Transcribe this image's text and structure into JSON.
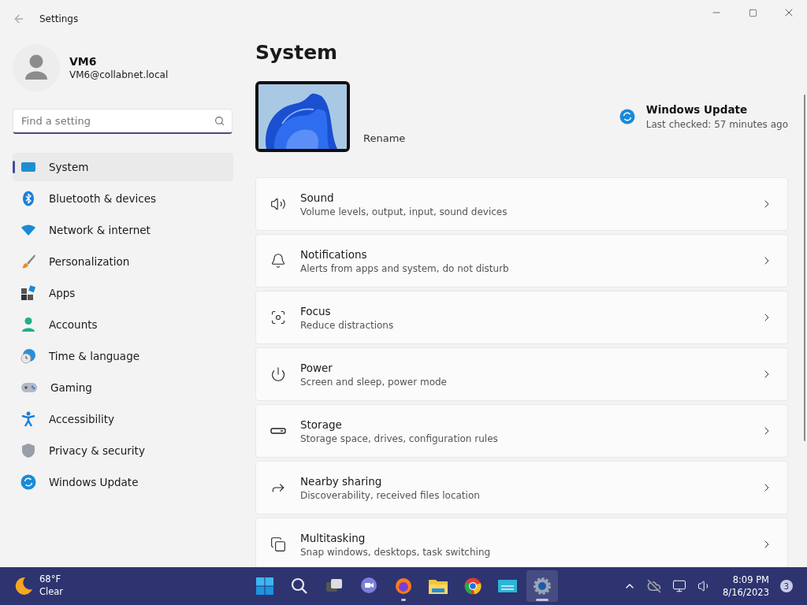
{
  "window": {
    "title": "Settings"
  },
  "user": {
    "name": "VM6",
    "email": "VM6@collabnet.local"
  },
  "search": {
    "placeholder": "Find a setting"
  },
  "sidebar": {
    "items": [
      {
        "label": "System",
        "selected": true
      },
      {
        "label": "Bluetooth & devices",
        "selected": false
      },
      {
        "label": "Network & internet",
        "selected": false
      },
      {
        "label": "Personalization",
        "selected": false
      },
      {
        "label": "Apps",
        "selected": false
      },
      {
        "label": "Accounts",
        "selected": false
      },
      {
        "label": "Time & language",
        "selected": false
      },
      {
        "label": "Gaming",
        "selected": false
      },
      {
        "label": "Accessibility",
        "selected": false
      },
      {
        "label": "Privacy & security",
        "selected": false
      },
      {
        "label": "Windows Update",
        "selected": false
      }
    ]
  },
  "page": {
    "title": "System",
    "rename": "Rename",
    "update": {
      "title": "Windows Update",
      "status": "Last checked: 57 minutes ago"
    }
  },
  "settings": [
    {
      "title": "Sound",
      "description": "Volume levels, output, input, sound devices"
    },
    {
      "title": "Notifications",
      "description": "Alerts from apps and system, do not disturb"
    },
    {
      "title": "Focus",
      "description": "Reduce distractions"
    },
    {
      "title": "Power",
      "description": "Screen and sleep, power mode"
    },
    {
      "title": "Storage",
      "description": "Storage space, drives, configuration rules"
    },
    {
      "title": "Nearby sharing",
      "description": "Discoverability, received files location"
    },
    {
      "title": "Multitasking",
      "description": "Snap windows, desktops, task switching"
    }
  ],
  "taskbar": {
    "weather": {
      "temperature": "68°F",
      "condition": "Clear"
    },
    "apps": [
      {
        "selected": false,
        "running": false
      },
      {
        "selected": false,
        "running": false
      },
      {
        "selected": false,
        "running": false
      },
      {
        "selected": false,
        "running": false
      },
      {
        "selected": false,
        "running": true
      },
      {
        "selected": false,
        "running": false
      },
      {
        "selected": false,
        "running": false
      },
      {
        "selected": false,
        "running": false
      },
      {
        "selected": true,
        "running": true
      }
    ],
    "time": "8:09 PM",
    "date": "8/16/2023",
    "notifications": "3"
  }
}
